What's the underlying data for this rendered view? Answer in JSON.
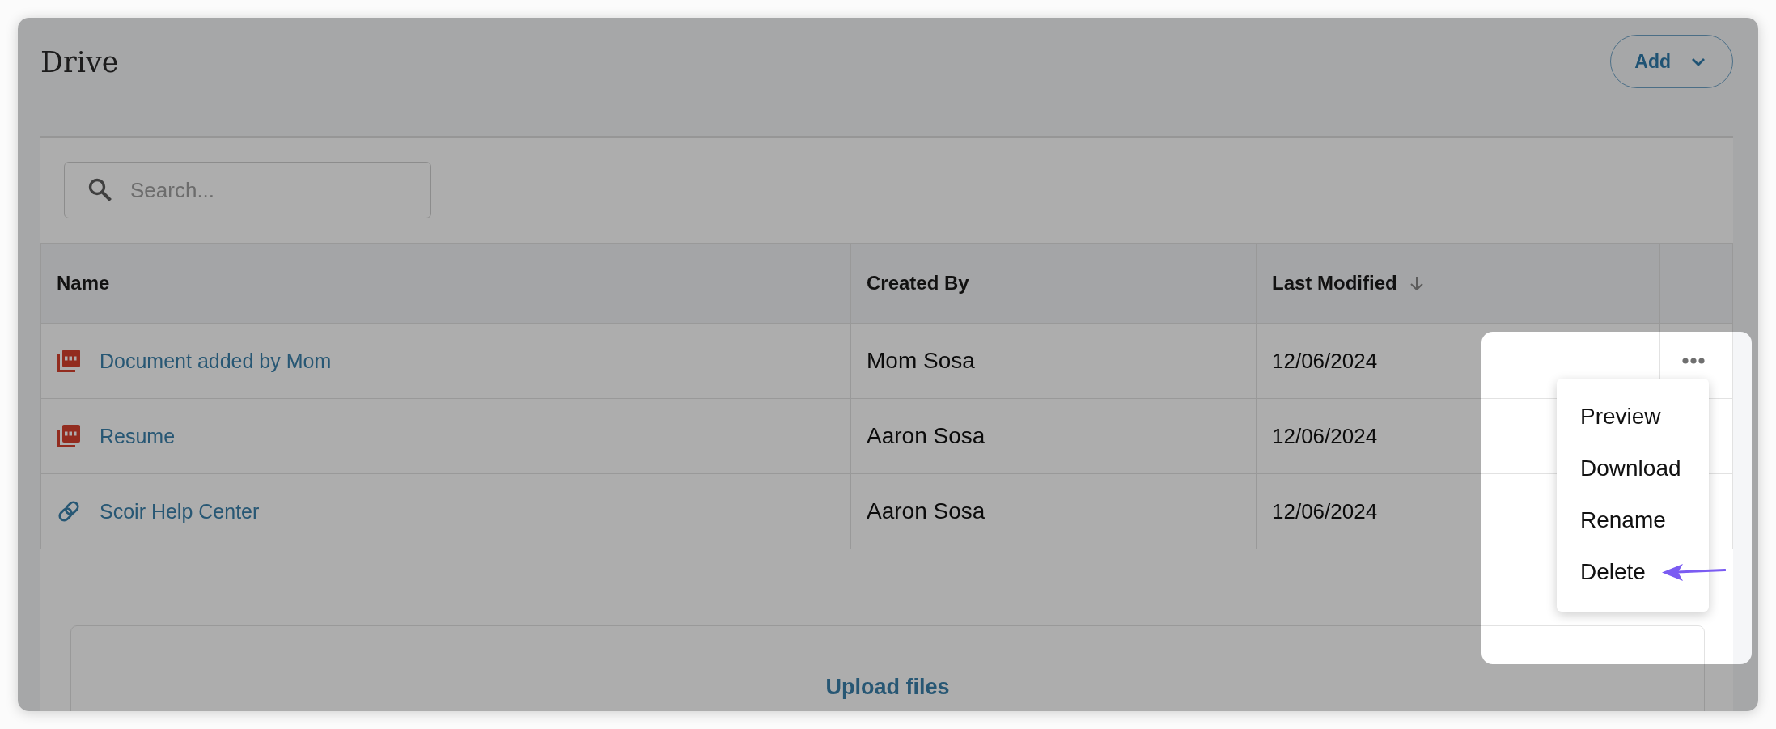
{
  "page": {
    "title": "Drive",
    "add_button": {
      "label": "Add"
    }
  },
  "search": {
    "placeholder": "Search..."
  },
  "table": {
    "columns": [
      {
        "label": "Name",
        "sorted": false
      },
      {
        "label": "Created By",
        "sorted": false
      },
      {
        "label": "Last Modified",
        "sorted": true
      }
    ],
    "rows": [
      {
        "kind": "pdf",
        "name": "Document added by Mom",
        "created_by": "Mom Sosa",
        "last_modified": "12/06/2024",
        "menu_open": true
      },
      {
        "kind": "pdf",
        "name": "Resume",
        "created_by": "Aaron Sosa",
        "last_modified": "12/06/2024",
        "menu_open": false
      },
      {
        "kind": "link",
        "name": "Scoir Help Center",
        "created_by": "Aaron Sosa",
        "last_modified": "12/06/2024",
        "menu_open": false
      }
    ]
  },
  "row_menu": {
    "items": [
      {
        "label": "Preview",
        "annotated": false
      },
      {
        "label": "Download",
        "annotated": false
      },
      {
        "label": "Rename",
        "annotated": false
      },
      {
        "label": "Delete",
        "annotated": true
      }
    ]
  },
  "upload": {
    "label": "Upload files"
  }
}
